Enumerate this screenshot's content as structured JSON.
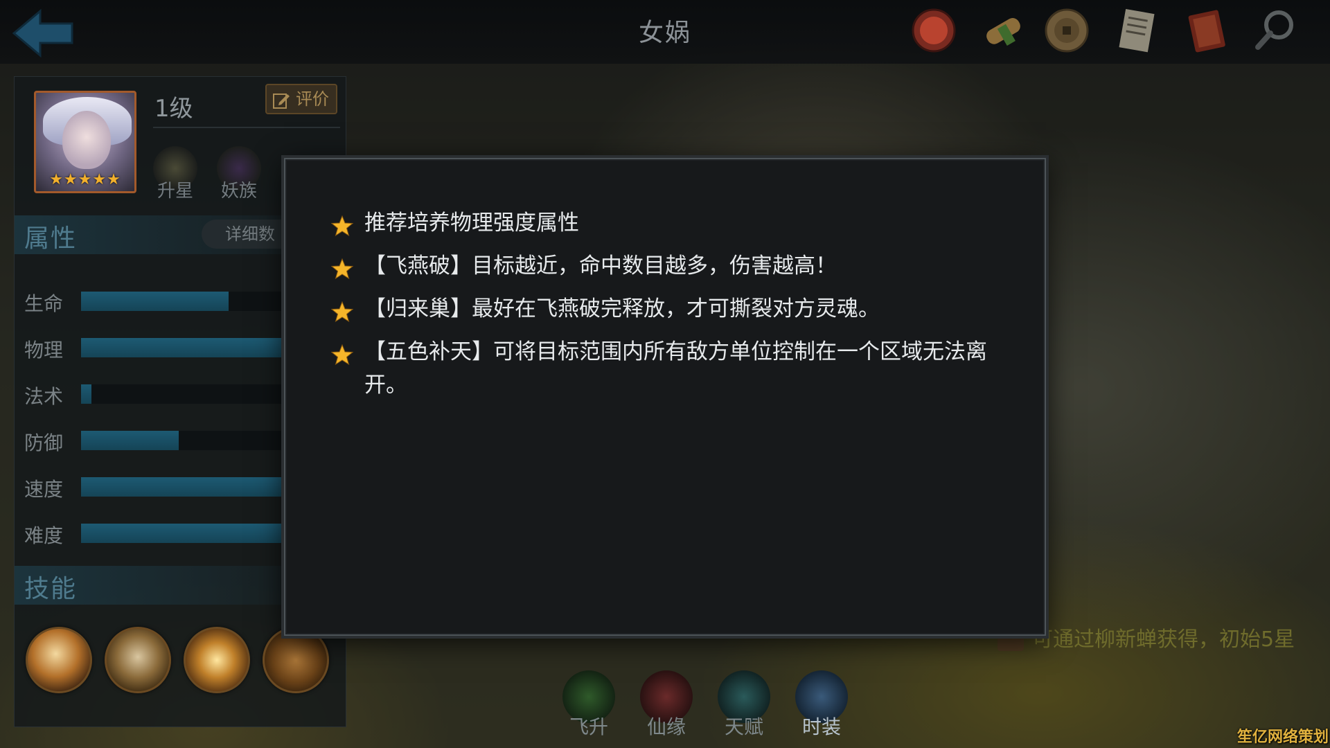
{
  "header": {
    "title": "女娲",
    "top_icons": [
      "trial-seal-icon",
      "scroll-icon",
      "coin-icon",
      "document-icon",
      "book-icon",
      "magnifier-icon"
    ]
  },
  "hero": {
    "level": "1级",
    "rate_label": "评价",
    "stars": "★★★★★",
    "badges": [
      {
        "label": "升星"
      },
      {
        "label": "妖族"
      }
    ]
  },
  "attributes": {
    "title": "属性",
    "detail_label": "详细数",
    "stats": [
      {
        "name": "生命",
        "value": 0.71
      },
      {
        "name": "物理",
        "value": 1.0
      },
      {
        "name": "法术",
        "value": 0.05
      },
      {
        "name": "防御",
        "value": 0.47
      },
      {
        "name": "速度",
        "value": 1.0
      },
      {
        "name": "难度",
        "value": 1.0
      }
    ]
  },
  "skills": {
    "title": "技能",
    "items": [
      "skill-1-icon",
      "skill-2-icon",
      "skill-3-icon",
      "skill-4-icon"
    ]
  },
  "bottom_nav": [
    {
      "label": "飞升"
    },
    {
      "label": "仙缘"
    },
    {
      "label": "天赋"
    },
    {
      "label": "时装"
    }
  ],
  "acquire_text": "可通过柳新蝉获得，初始5星",
  "modal": {
    "tips": [
      "推荐培养物理强度属性",
      "【飞燕破】目标越近，命中数目越多，伤害越高！",
      "【归来巢】最好在飞燕破完释放，才可撕裂对方灵魂。",
      "【五色补天】可将目标范围内所有敌方单位控制在一个区域无法离开。"
    ]
  },
  "watermark": "笙亿网络策划",
  "colors": {
    "accent": "#4f7b8e",
    "star": "#f2b02c",
    "bar": "#1d5a73"
  }
}
